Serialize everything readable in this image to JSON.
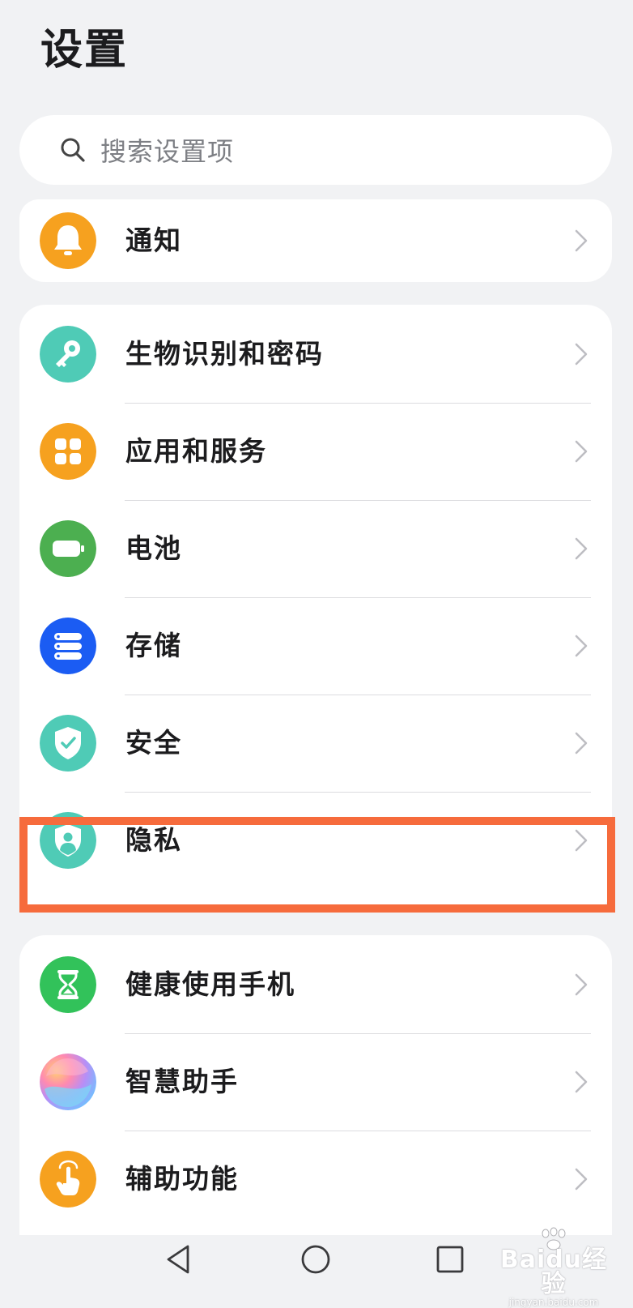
{
  "header": {
    "title": "设置"
  },
  "search": {
    "placeholder": "搜索设置项"
  },
  "groups": [
    {
      "items": [
        {
          "label": "通知",
          "icon": "bell-icon",
          "color": "#f6a11f"
        }
      ]
    },
    {
      "items": [
        {
          "label": "生物识别和密码",
          "icon": "key-icon",
          "color": "#4fcbb6"
        },
        {
          "label": "应用和服务",
          "icon": "apps-grid-icon",
          "color": "#f6a11f"
        },
        {
          "label": "电池",
          "icon": "battery-icon",
          "color": "#4caf50"
        },
        {
          "label": "存储",
          "icon": "storage-icon",
          "color": "#1b5cf3"
        },
        {
          "label": "安全",
          "icon": "security-shield-icon",
          "color": "#4fcbb6"
        },
        {
          "label": "隐私",
          "icon": "privacy-shield-icon",
          "color": "#4fcbb6",
          "highlighted": true
        }
      ]
    },
    {
      "items": [
        {
          "label": "健康使用手机",
          "icon": "hourglass-icon",
          "color": "#32c25a"
        },
        {
          "label": "智慧助手",
          "icon": "assistant-orb-icon",
          "color": "#b88ef6"
        },
        {
          "label": "辅助功能",
          "icon": "accessibility-hand-icon",
          "color": "#f6a11f"
        }
      ]
    }
  ],
  "highlight": {
    "color": "#f66b3c",
    "target": "隐私"
  },
  "navigation": {
    "buttons": [
      "back-icon",
      "home-icon",
      "recent-apps-icon"
    ]
  },
  "watermark": {
    "logo": "Baidu经验",
    "url": "jingyan.baidu.com"
  }
}
